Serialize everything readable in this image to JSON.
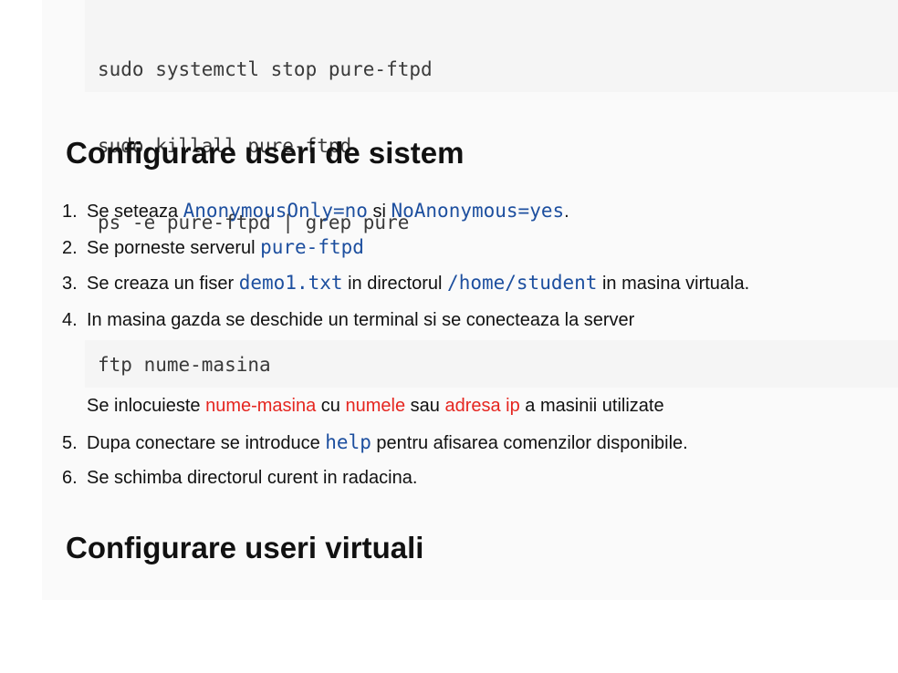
{
  "top_code": {
    "lines": [
      "sudo systemctl stop pure-ftpd",
      "sudo killall pure-ftpd",
      "ps -e pure-ftpd | grep pure"
    ]
  },
  "section_system": {
    "heading": "Configurare useri de sistem",
    "steps": [
      {
        "num": "1.",
        "text_a": "Se seteaza ",
        "code_a": "AnonymousOnly=no",
        "text_b": " si ",
        "code_b": "NoAnonymous=yes",
        "text_c": "."
      },
      {
        "num": "2.",
        "text_a": "Se porneste serverul ",
        "code_a": "pure-ftpd"
      },
      {
        "num": "3.",
        "text_a": "Se creaza un fiser ",
        "code_a": "demo1.txt",
        "text_b": " in directorul ",
        "code_b": "/home/student",
        "text_c": " in masina virtuala."
      },
      {
        "num": "4.",
        "text_a": "In masina gazda se deschide un terminal si se conecteaza la server",
        "code_block": "ftp nume-masina",
        "note_a": "Se inlocuieste ",
        "note_red_a": "nume-masina",
        "note_b": " cu ",
        "note_red_b": "numele",
        "note_c": " sau ",
        "note_red_c": "adresa ip",
        "note_d": " a masinii utilizate"
      },
      {
        "num": "5.",
        "text_a": "Dupa conectare se introduce ",
        "code_a": "help",
        "text_b": " pentru afisarea comenzilor disponibile."
      },
      {
        "num": "6.",
        "text_a": "Se schimba directorul curent in radacina."
      }
    ]
  },
  "section_virtual": {
    "heading": "Configurare useri virtuali"
  },
  "colors": {
    "code_text": "#1d4f9f",
    "highlight_red": "#e52620",
    "panel_background": "#fafafa",
    "code_background": "#f5f5f5"
  }
}
